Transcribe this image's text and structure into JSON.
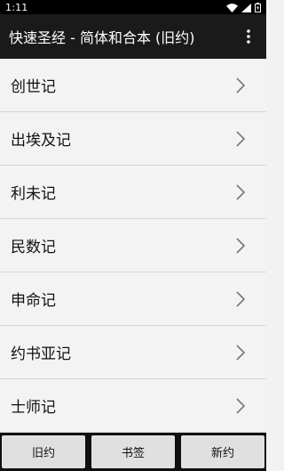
{
  "status_bar": {
    "time": "1:11",
    "icons": [
      "wifi-icon",
      "signal-icon",
      "battery-icon"
    ]
  },
  "app_bar": {
    "title": "快速圣经 - 简体和合本 (旧约)",
    "menu_icon": "more-vert-icon"
  },
  "books": [
    {
      "label": "创世记"
    },
    {
      "label": "出埃及记"
    },
    {
      "label": "利未记"
    },
    {
      "label": "民数记"
    },
    {
      "label": "申命记"
    },
    {
      "label": "约书亚记"
    },
    {
      "label": "士师记"
    }
  ],
  "bottom_nav": {
    "old_testament": "旧约",
    "bookmarks": "书签",
    "new_testament": "新约"
  },
  "colors": {
    "app_bar": "#1a1a1a",
    "list_background": "#f2f2f2",
    "button": "#e0e0e0"
  }
}
